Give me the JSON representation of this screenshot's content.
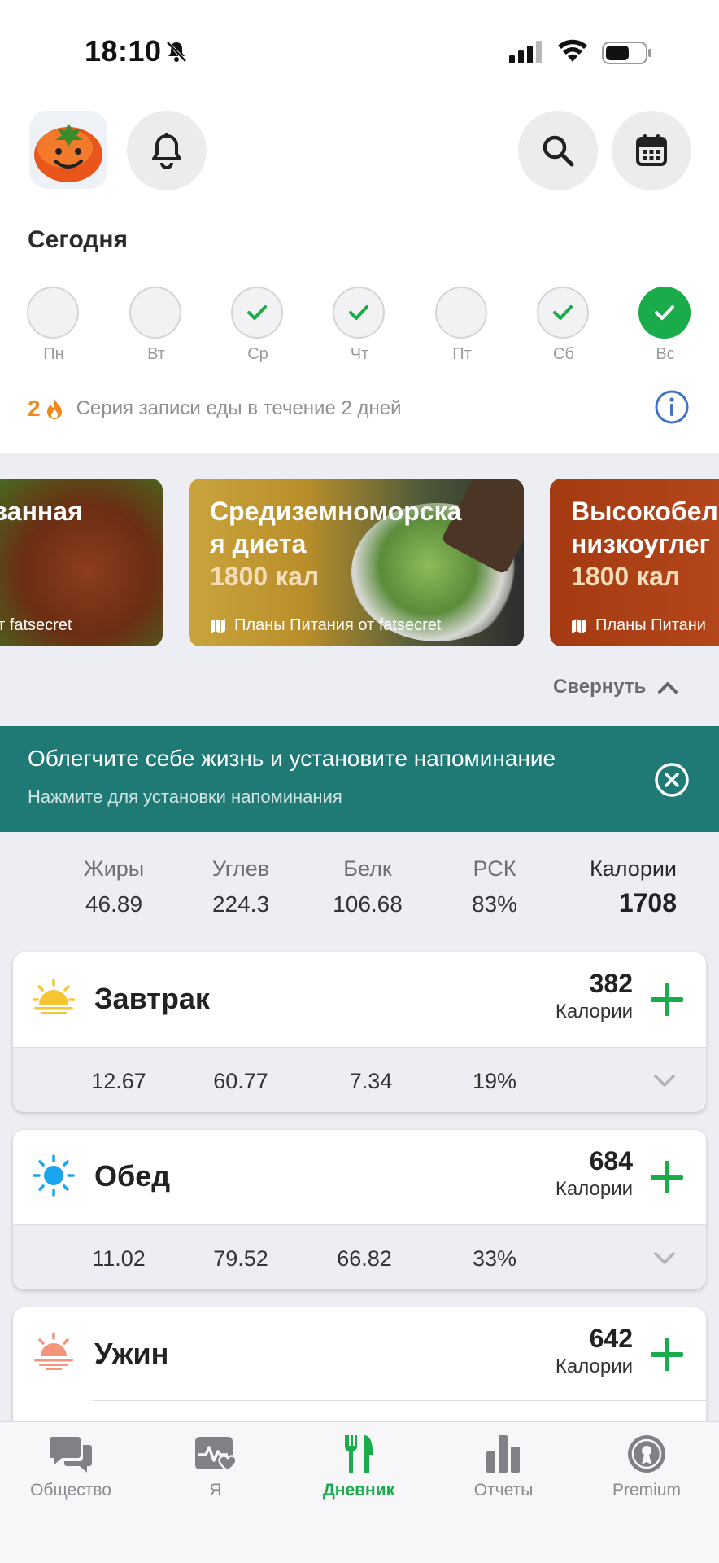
{
  "status_bar": {
    "time": "18:10"
  },
  "header": {
    "today_title": "Сегодня"
  },
  "week": {
    "days": [
      {
        "label": "Пн",
        "state": "empty"
      },
      {
        "label": "Вт",
        "state": "empty"
      },
      {
        "label": "Ср",
        "state": "done"
      },
      {
        "label": "Чт",
        "state": "done"
      },
      {
        "label": "Пт",
        "state": "empty"
      },
      {
        "label": "Сб",
        "state": "done"
      },
      {
        "label": "Вс",
        "state": "today"
      }
    ]
  },
  "streak": {
    "count": "2",
    "text": "Серия записи еды в течение 2 дней"
  },
  "meal_plans": [
    {
      "title_line1": "ованная",
      "title_line2": "",
      "calories": "",
      "footer": "я от fatsecret"
    },
    {
      "title_line1": "Средиземноморска",
      "title_line2": "я диета",
      "calories": "1800 кал",
      "footer": "Планы Питания от fatsecret"
    },
    {
      "title_line1": "Высокобел",
      "title_line2": "низкоуглег",
      "calories": "1800 кал",
      "footer": "Планы Питани"
    }
  ],
  "collapse_label": "Свернуть",
  "reminder": {
    "title": "Облегчите себе жизнь и установите напоминание",
    "subtitle": "Нажмите для установки напоминания"
  },
  "summary": {
    "fat_label": "Жиры",
    "fat": "46.89",
    "carb_label": "Углев",
    "carb": "224.3",
    "protein_label": "Белк",
    "protein": "106.68",
    "rdi_label": "РСК",
    "rdi": "83%",
    "cal_label": "Калории",
    "cal": "1708"
  },
  "meals": [
    {
      "name": "Завтрак",
      "calories": "382",
      "cal_label": "Калории",
      "fat": "12.67",
      "carb": "60.77",
      "protein": "7.34",
      "rdi": "19%"
    },
    {
      "name": "Обед",
      "calories": "684",
      "cal_label": "Калории",
      "fat": "11.02",
      "carb": "79.52",
      "protein": "66.82",
      "rdi": "33%"
    },
    {
      "name": "Ужин",
      "calories": "642",
      "cal_label": "Калории"
    }
  ],
  "tabbar": {
    "community": "Общество",
    "me": "Я",
    "diary": "Дневник",
    "reports": "Отчеты",
    "premium": "Premium"
  },
  "colors": {
    "accent_green": "#1aab4b",
    "reminder_teal": "#1f7a76",
    "streak_orange": "#f08a1c",
    "info_blue": "#3f72c8"
  },
  "icons": [
    "tomato-avatar",
    "bell-icon",
    "search-icon",
    "calendar-icon",
    "check-icon",
    "flame-icon",
    "info-icon",
    "map-icon",
    "chevron-up-icon",
    "close-circle-icon",
    "sunrise-icon",
    "sun-icon",
    "sunset-icon",
    "plus-icon",
    "chevron-down-icon",
    "chat-icon",
    "heart-pulse-icon",
    "fork-knife-icon",
    "bar-chart-icon",
    "premium-badge-icon"
  ]
}
